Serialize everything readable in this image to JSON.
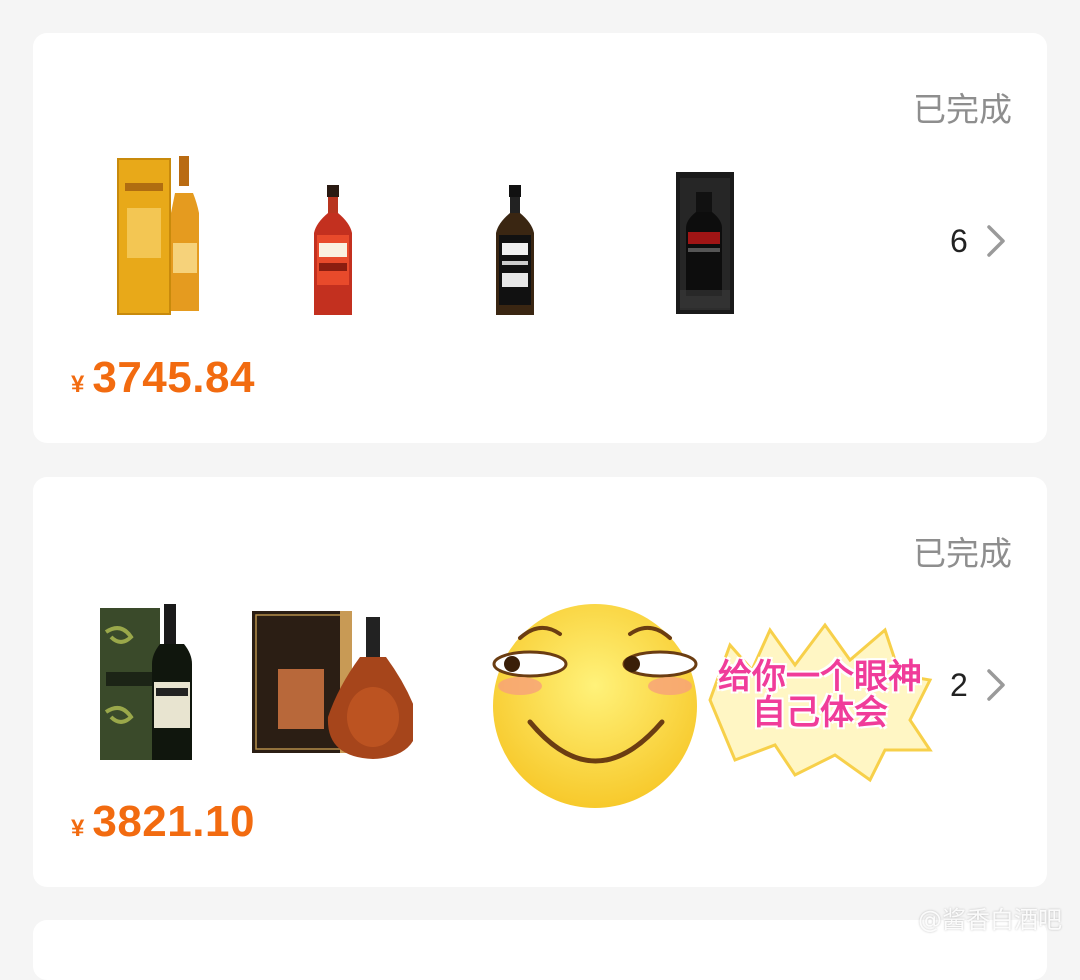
{
  "orders": [
    {
      "status": "已完成",
      "item_count": "6",
      "currency": "¥",
      "price": "3745.84",
      "products": [
        "glenmorangie-bottle-icon",
        "jack-daniels-fire-bottle-icon",
        "jack-daniels-bottle-icon",
        "dark-gift-box-bottle-icon"
      ]
    },
    {
      "status": "已完成",
      "item_count": "2",
      "currency": "¥",
      "price": "3821.10",
      "products": [
        "ardbeg-bottle-icon",
        "hennessy-xo-bottle-icon"
      ]
    }
  ],
  "sticker": {
    "line1": "给你一个眼神",
    "line2": "自己体会"
  },
  "watermark": "@酱香白酒吧",
  "colors": {
    "price": "#f26b10",
    "status": "#8e8e8e",
    "background": "#f5f5f5"
  }
}
